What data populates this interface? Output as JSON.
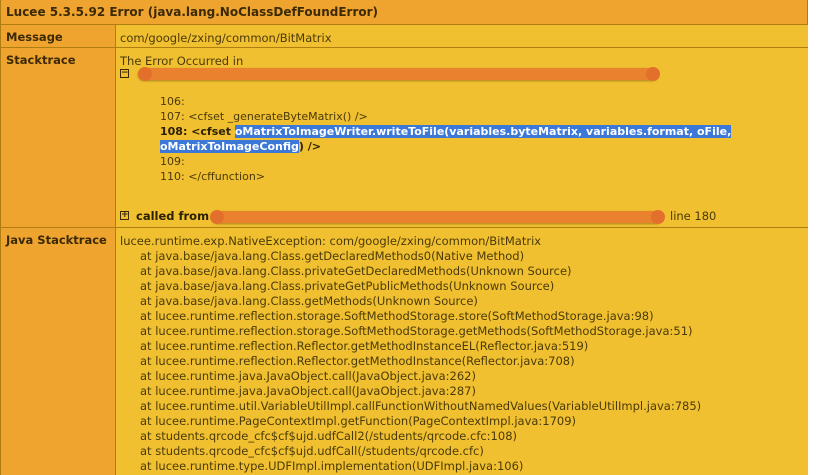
{
  "title": "Lucee 5.3.5.92 Error (java.lang.NoClassDefFoundError)",
  "message": {
    "label": "Message",
    "value": "com/google/zxing/common/BitMatrix"
  },
  "stacktrace": {
    "label": "Stacktrace",
    "intro": "The Error Occurred in",
    "toggle_open": "−",
    "toggle_closed": "+",
    "code_lines": {
      "l106": "106:",
      "l107": "107: <cfset _generateByteMatrix() />",
      "l108_prefix": "108: <cfset ",
      "l108_selected_a": "oMatrixToImageWriter.writeToFile(variables.byteMatrix, variables.format, oFile,",
      "l108_selected_b": "oMatrixToImageConfig",
      "l108_suffix": ") />",
      "l109": "109:",
      "l110": "110: </cffunction>"
    },
    "called_from": "called from",
    "called_from_line": "line 180"
  },
  "java_stacktrace": {
    "label": "Java Stacktrace",
    "head": "lucee.runtime.exp.NativeException: com/google/zxing/common/BitMatrix",
    "lines": [
      "at java.base/java.lang.Class.getDeclaredMethods0(Native Method)",
      "at java.base/java.lang.Class.privateGetDeclaredMethods(Unknown Source)",
      "at java.base/java.lang.Class.privateGetPublicMethods(Unknown Source)",
      "at java.base/java.lang.Class.getMethods(Unknown Source)",
      "at lucee.runtime.reflection.storage.SoftMethodStorage.store(SoftMethodStorage.java:98)",
      "at lucee.runtime.reflection.storage.SoftMethodStorage.getMethods(SoftMethodStorage.java:51)",
      "at lucee.runtime.reflection.Reflector.getMethodInstanceEL(Reflector.java:519)",
      "at lucee.runtime.reflection.Reflector.getMethodInstance(Reflector.java:708)",
      "at lucee.runtime.java.JavaObject.call(JavaObject.java:262)",
      "at lucee.runtime.java.JavaObject.call(JavaObject.java:287)",
      "at lucee.runtime.util.VariableUtilImpl.callFunctionWithoutNamedValues(VariableUtilImpl.java:785)",
      "at lucee.runtime.PageContextImpl.getFunction(PageContextImpl.java:1709)",
      "at students.qrcode_cfc$cf$ujd.udfCall2(/students/qrcode.cfc:108)",
      "at students.qrcode_cfc$cf$ujd.udfCall(/students/qrcode.cfc)",
      "at lucee.runtime.type.UDFImpl.implementation(UDFImpl.java:106)"
    ]
  },
  "colors": {
    "header_orange": "#f0a430",
    "value_yellow": "#f0c030",
    "border": "#b07d10",
    "selection": "#3b78d8",
    "redaction": "#e8772e"
  }
}
